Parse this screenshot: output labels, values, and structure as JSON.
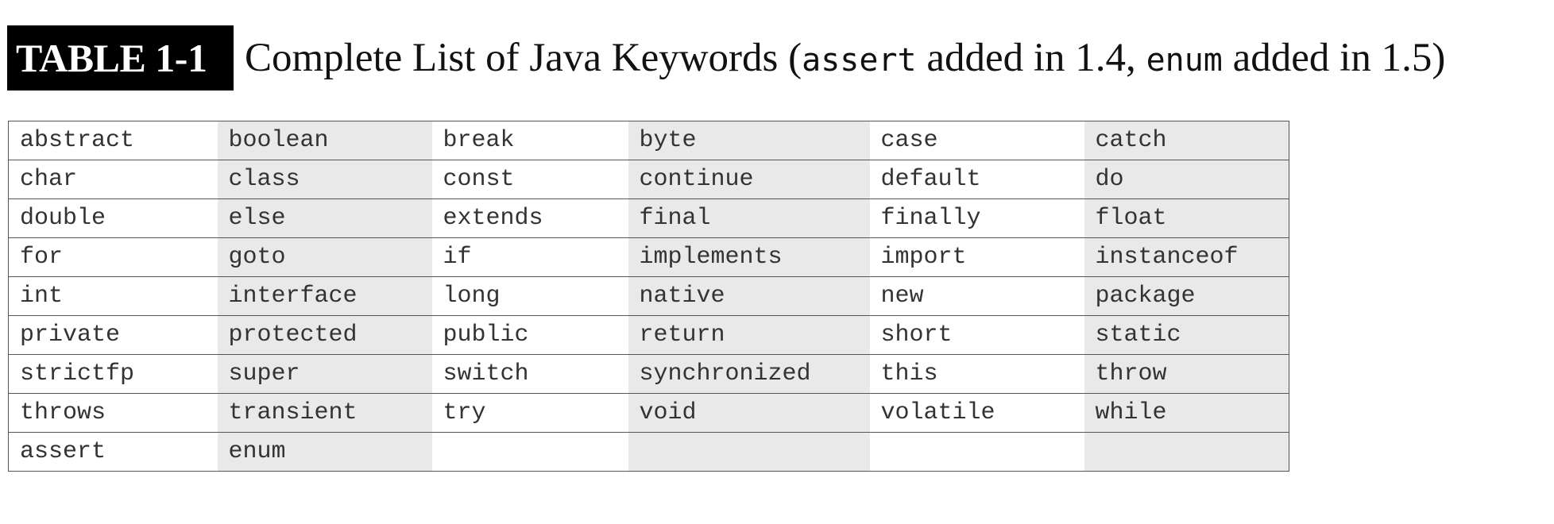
{
  "caption": {
    "label": "TABLE 1-1",
    "title_prefix": "Complete List of Java Keywords (",
    "kw1": "assert",
    "mid1": " added in 1.4, ",
    "kw2": "enum",
    "suffix": " added in 1.5)"
  },
  "keywords": [
    [
      "abstract",
      "boolean",
      "break",
      "byte",
      "case",
      "catch"
    ],
    [
      "char",
      "class",
      "const",
      "continue",
      "default",
      "do"
    ],
    [
      "double",
      "else",
      "extends",
      "final",
      "finally",
      "float"
    ],
    [
      "for",
      "goto",
      "if",
      "implements",
      "import",
      "instanceof"
    ],
    [
      "int",
      "interface",
      "long",
      "native",
      "new",
      "package"
    ],
    [
      "private",
      "protected",
      "public",
      "return",
      "short",
      "static"
    ],
    [
      "strictfp",
      "super",
      "switch",
      "synchronized",
      "this",
      "throw"
    ],
    [
      "throws",
      "transient",
      "try",
      "void",
      "volatile",
      "while"
    ],
    [
      "assert",
      "enum",
      "",
      "",
      "",
      ""
    ]
  ],
  "colors": {
    "label_bg": "#000000",
    "label_text": "#ffffff",
    "shade": "#e9e9e9",
    "rule": "#555555"
  }
}
